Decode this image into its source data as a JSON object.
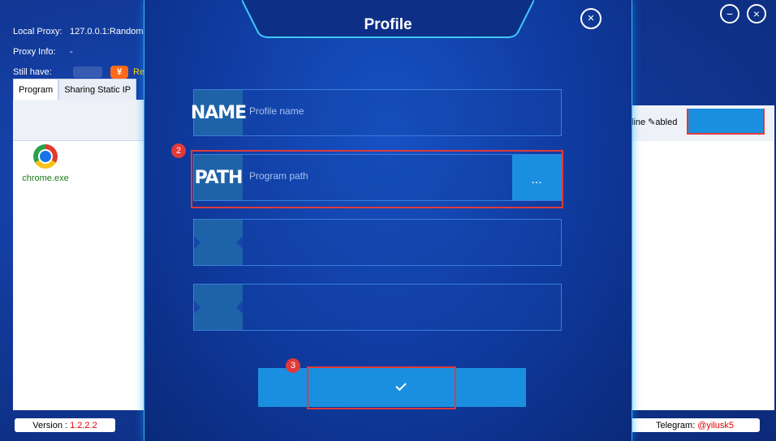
{
  "app": {
    "info": {
      "local_proxy_label": "Local Proxy:",
      "local_proxy_value": "127.0.0.1:Random",
      "proxy_info_label": "Proxy Info:",
      "proxy_info_value": "-",
      "still_have_label": "Still have:",
      "coin_symbol": "¥",
      "recharge_text": "Re"
    },
    "tabs": [
      {
        "label": "Program"
      },
      {
        "label": "Sharing Static IP"
      }
    ],
    "programs": [
      {
        "label": "chrome.exe",
        "icon": "chrome-icon"
      }
    ],
    "right_header_label": "line ✎abled",
    "footer": {
      "version_label": "Version :",
      "version_value": "1.2.2.2",
      "telegram_label": "Telegram:",
      "telegram_value": "@yilusk5"
    },
    "window_buttons": {
      "minimize": "−",
      "close": "×"
    }
  },
  "dialog": {
    "title": "Profile",
    "close_glyph": "×",
    "fields": [
      {
        "tag": "NAME",
        "placeholder": "Profile name"
      },
      {
        "tag": "PATH",
        "placeholder": "Program path",
        "browse_label": "..."
      }
    ],
    "badges": {
      "step2": "2",
      "step3": "3"
    }
  },
  "colors": {
    "accent": "#1a8fe0",
    "highlight": "#e03a3a",
    "background": "#123a9a"
  }
}
